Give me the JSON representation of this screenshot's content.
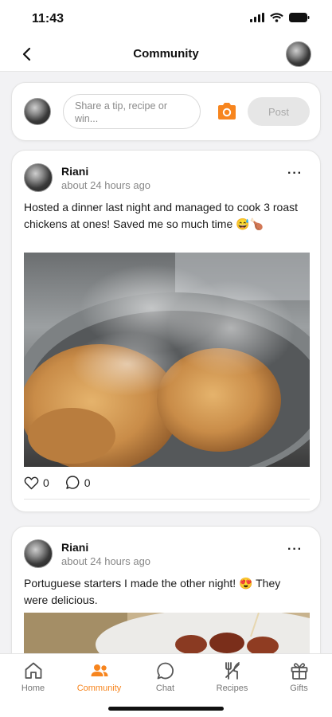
{
  "status_bar": {
    "time": "11:43"
  },
  "nav": {
    "title": "Community"
  },
  "composer": {
    "placeholder": "Share a tip, recipe or win...",
    "post_label": "Post"
  },
  "posts": [
    {
      "author": "Riani",
      "time": "about 24 hours ago",
      "text": "Hosted a dinner last night and managed to cook 3 roast chickens at ones! Saved me so much time 😅🍗",
      "likes": "0",
      "comments": "0"
    },
    {
      "author": "Riani",
      "time": "about 24 hours ago",
      "text": "Portuguese starters I made the other night! 😍 They were delicious."
    }
  ],
  "tabs": [
    {
      "label": "Home",
      "icon": "home-icon"
    },
    {
      "label": "Community",
      "icon": "community-icon",
      "active": true
    },
    {
      "label": "Chat",
      "icon": "chat-icon"
    },
    {
      "label": "Recipes",
      "icon": "recipes-icon"
    },
    {
      "label": "Gifts",
      "icon": "gift-icon"
    }
  ],
  "colors": {
    "accent": "#f7851e",
    "background": "#f2f2f4"
  }
}
